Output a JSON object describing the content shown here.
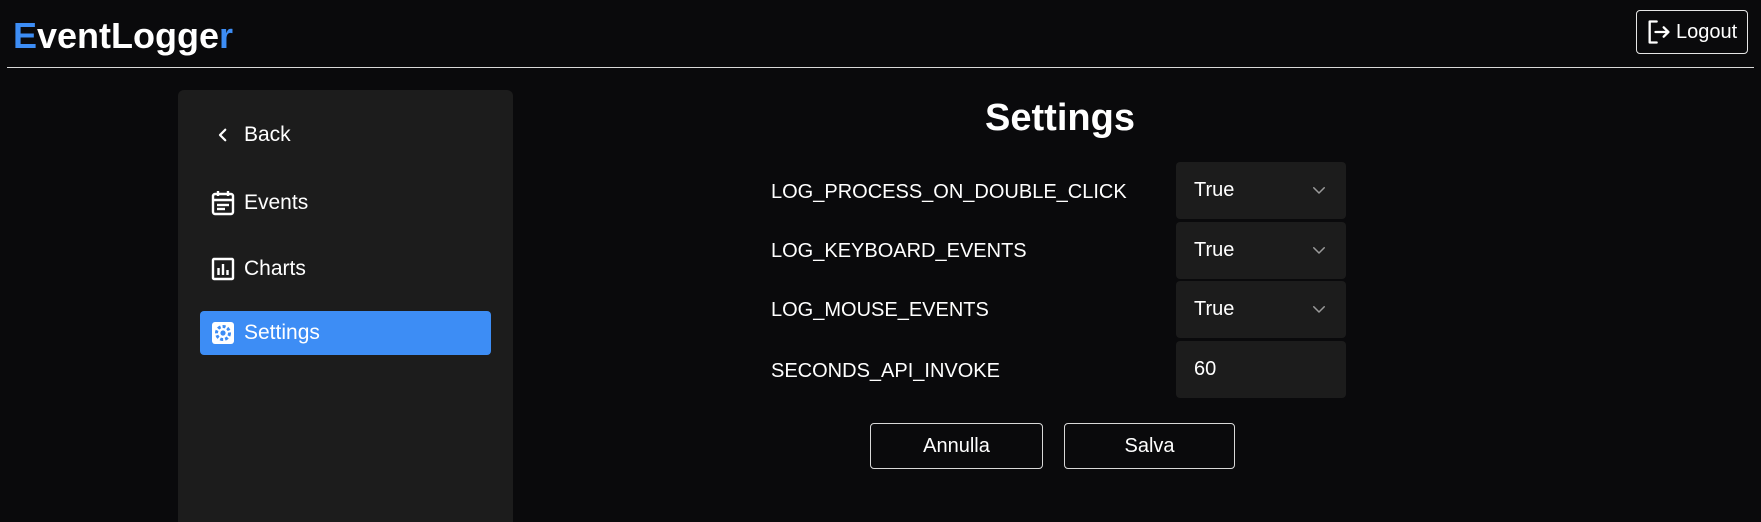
{
  "app": {
    "brand_first": "E",
    "brand_middle": "ventLogge",
    "brand_last": "r",
    "logout_label": "Logout"
  },
  "sidebar": {
    "items": [
      {
        "label": "Back",
        "icon": "chevron-left-icon"
      },
      {
        "label": "Events",
        "icon": "calendar-icon"
      },
      {
        "label": "Charts",
        "icon": "bar-chart-icon"
      },
      {
        "label": "Settings",
        "icon": "gear-icon",
        "active": true
      }
    ]
  },
  "main": {
    "title": "Settings",
    "settings": [
      {
        "label": "LOG_PROCESS_ON_DOUBLE_CLICK",
        "type": "select",
        "value": "True"
      },
      {
        "label": "LOG_KEYBOARD_EVENTS",
        "type": "select",
        "value": "True"
      },
      {
        "label": "LOG_MOUSE_EVENTS",
        "type": "select",
        "value": "True"
      },
      {
        "label": "SECONDS_API_INVOKE",
        "type": "number",
        "value": "60"
      }
    ],
    "cancel_label": "Annulla",
    "save_label": "Salva"
  },
  "colors": {
    "background": "#0a0a0c",
    "panel": "#1c1c1c",
    "accent": "#3d8df5",
    "text": "#ffffff"
  }
}
